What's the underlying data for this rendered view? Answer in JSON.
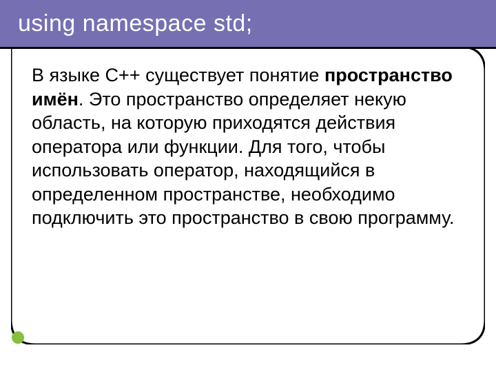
{
  "title": "using namespace std;",
  "body": {
    "pre": "В языке С++ существует понятие ",
    "bold": "пространство имён",
    "post": ". Это пространство определяет некую область, на которую приходятся действия оператора или функции. Для того, чтобы использовать оператор, находящийся в определенном пространстве, необходимо подключить это пространство в свою программу."
  },
  "colors": {
    "title_bg": "#7670b2",
    "accent_green": "#87bf3e"
  }
}
